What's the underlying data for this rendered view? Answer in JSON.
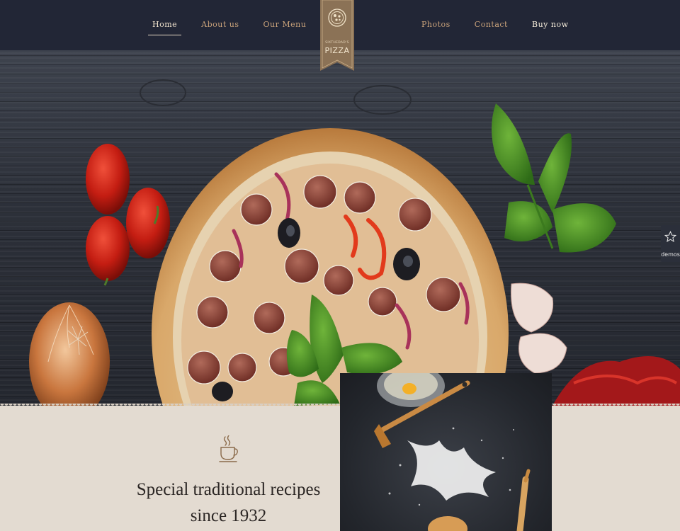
{
  "header": {
    "nav_left": [
      {
        "label": "Home",
        "active": true
      },
      {
        "label": "About us",
        "active": false
      },
      {
        "label": "Our Menu",
        "active": false
      }
    ],
    "nav_right": [
      {
        "label": "Photos"
      },
      {
        "label": "Contact"
      },
      {
        "label": "Buy now"
      }
    ],
    "logo": {
      "line1": "SIXTHEDAD'S",
      "line2": "PIZZA",
      "icon": "pizza-icon"
    }
  },
  "hero": {
    "image": "pizza-on-dark-wood-table"
  },
  "demos": {
    "label": "demos",
    "icon": "star-icon"
  },
  "intro": {
    "icon": "coffee-cup-icon",
    "headline_line1": "Special traditional recipes",
    "headline_line2": "since 1932"
  },
  "colors": {
    "header_bg": "#222636",
    "nav_link": "#c9a27a",
    "paper_bg": "#e3dbd1",
    "accent": "#8a6a4a"
  }
}
